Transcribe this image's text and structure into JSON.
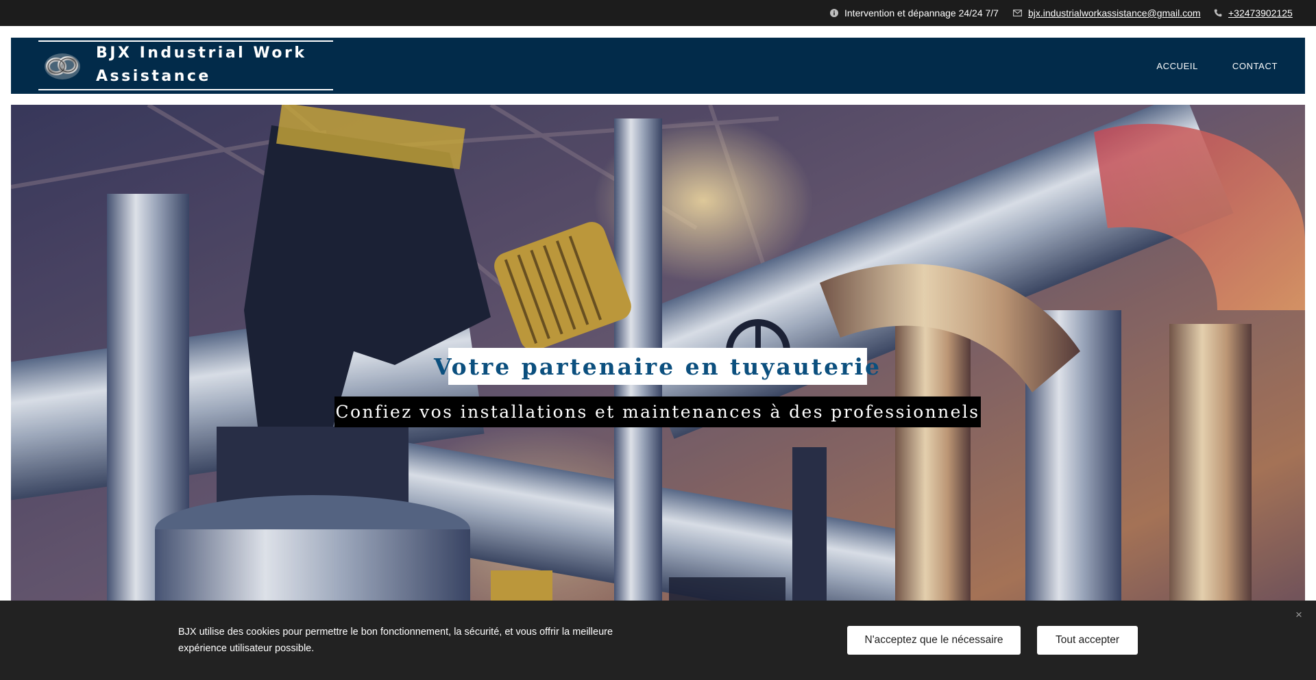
{
  "topbar": {
    "intervention": "Intervention et dépannage 24/24 7/7",
    "email": "bjx.industrialworkassistance@gmail.com",
    "phone": "+32473902125"
  },
  "header": {
    "brand_line1": "BJX Industrial Work",
    "brand_line2": "Assistance",
    "nav": [
      {
        "label": "ACCUEIL"
      },
      {
        "label": "CONTACT"
      }
    ]
  },
  "hero": {
    "title": "Votre partenaire en tuyauterie",
    "subtitle": "Confiez vos installations et maintenances à des professionnels"
  },
  "cookie_banner": {
    "text": "BJX utilise des cookies pour permettre le bon fonctionnement, la sécurité, et vous offrir la meilleure expérience utilisateur possible.",
    "necessary_label": "N'acceptez que le nécessaire",
    "accept_label": "Tout accepter",
    "close_label": "×"
  },
  "colors": {
    "topbar_bg": "#1c1c1c",
    "header_bg": "#022b4a",
    "title_color": "#0b4f7e",
    "cookie_bg": "#222222"
  },
  "icons": [
    "info-icon",
    "mail-icon",
    "phone-icon",
    "logo-icon",
    "close-icon"
  ]
}
